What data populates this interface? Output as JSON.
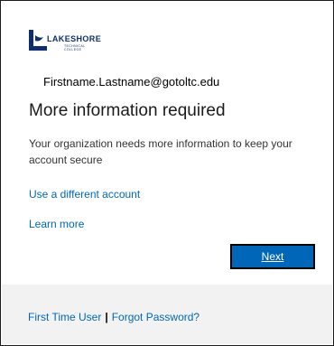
{
  "logo": {
    "wordmark": "LAKESHORE",
    "sub1": "TECHNICAL",
    "sub2": "COLLEGE",
    "brand_color": "#0e2e6e"
  },
  "account": {
    "email": "Firstname.Lastname@gotoltc.edu"
  },
  "main": {
    "heading": "More information required",
    "description": "Your organization needs more information to keep your account secure",
    "use_different_account": "Use a different account",
    "learn_more": "Learn more",
    "next_label": "Next"
  },
  "footer": {
    "first_time_user": "First Time User",
    "separator": "|",
    "forgot_password": "Forgot Password?"
  },
  "colors": {
    "accent": "#0067b8",
    "footer_bg": "#f2f2f2"
  }
}
